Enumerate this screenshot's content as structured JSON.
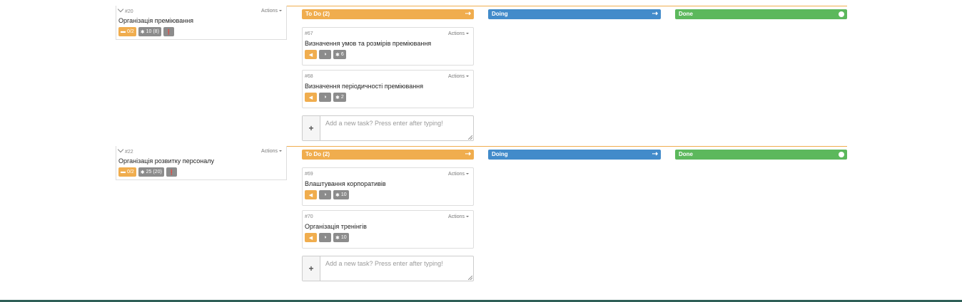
{
  "stories": [
    {
      "id": "#20",
      "title": "Організація преміювання",
      "actions_label": "Actions",
      "badges": {
        "tasks": "0/2",
        "points": "10 (8)"
      },
      "columns": {
        "todo": "To Do (2)",
        "doing": "Doing",
        "done": "Done"
      },
      "tasks": [
        {
          "id": "#67",
          "title": "Визначення умов та розмірів преміювання",
          "actions_label": "Actions",
          "points": "6"
        },
        {
          "id": "#68",
          "title": "Визначення періодичності преміювання",
          "actions_label": "Actions",
          "points": "2"
        }
      ],
      "add_placeholder": "Add a new task? Press enter after typing!"
    },
    {
      "id": "#22",
      "title": "Організація розвитку персоналу",
      "actions_label": "Actions",
      "badges": {
        "tasks": "0/2",
        "points": "25 (20)"
      },
      "columns": {
        "todo": "To Do (2)",
        "doing": "Doing",
        "done": "Done"
      },
      "tasks": [
        {
          "id": "#69",
          "title": "Влаштування корпоративів",
          "actions_label": "Actions",
          "points": "10"
        },
        {
          "id": "#70",
          "title": "Організація тренінгів",
          "actions_label": "Actions",
          "points": "10"
        }
      ],
      "add_placeholder": "Add a new task? Press enter after typing!"
    }
  ],
  "icons": {
    "chevron": "chevron-down-icon",
    "tasks": "folder-icon",
    "points": "asterisk-icon",
    "info": "info-icon",
    "move_left": "caret-left-icon",
    "progress": "half-circle-icon",
    "arrow": "arrow-right-icon",
    "done": "circle-icon",
    "add": "plus-icon"
  },
  "colors": {
    "todo": "#f0ad4e",
    "doing": "#428bca",
    "done": "#5cb85c",
    "grey_badge": "#8c8c8c",
    "footer": "#2f5f57"
  }
}
